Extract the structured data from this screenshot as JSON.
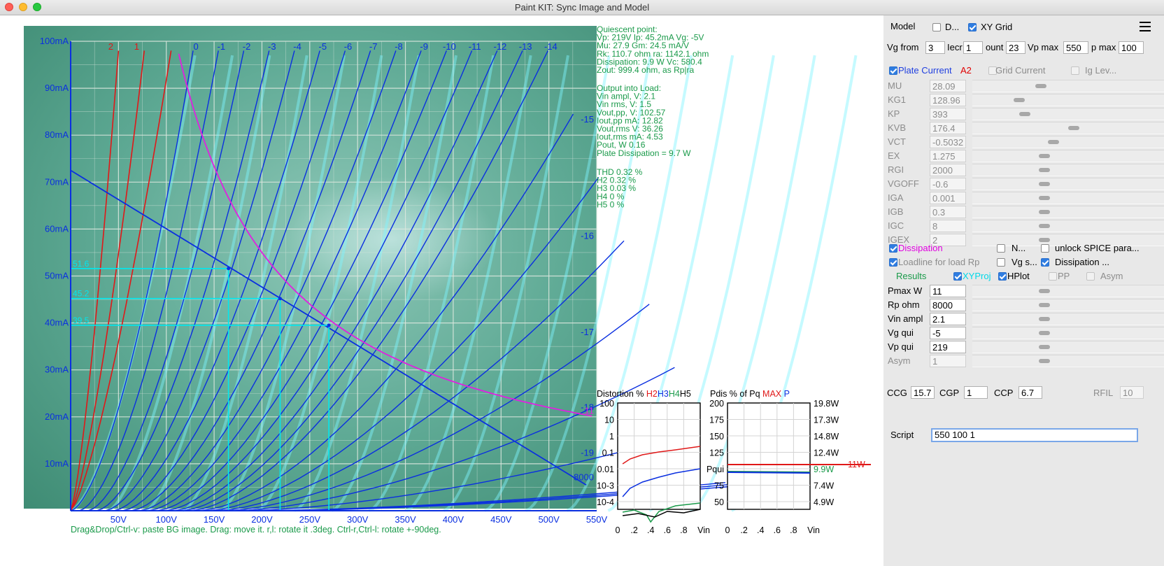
{
  "window": {
    "title": "Paint KIT: Sync Image and Model"
  },
  "chart_data": {
    "type": "line",
    "title": "",
    "xlabel": "",
    "ylabel": "",
    "xlim": [
      0,
      550
    ],
    "ylim": [
      0,
      100
    ],
    "x_ticks": [
      "50V",
      "100V",
      "150V",
      "200V",
      "250V",
      "300V",
      "350V",
      "400V",
      "450V",
      "500V",
      "550V"
    ],
    "y_ticks": [
      "10mA",
      "20mA",
      "30mA",
      "40mA",
      "50mA",
      "60mA",
      "70mA",
      "80mA",
      "90mA",
      "100mA"
    ],
    "grid": true,
    "positive_grid_labels": [
      "2",
      "1"
    ],
    "curve_top_labels": [
      "0",
      "-1",
      "-2",
      "-3",
      "-4",
      "-5",
      "-6",
      "-7",
      "-8",
      "-9",
      "-10",
      "-11",
      "-12",
      "-13",
      "-14"
    ],
    "curve_side_labels": [
      {
        "text": "-15",
        "y": 83.3
      },
      {
        "text": "-16",
        "y": 58.5
      },
      {
        "text": "-17",
        "y": 38.0
      },
      {
        "text": "-18",
        "y": 22.0
      },
      {
        "text": "-19",
        "y": 12.3
      },
      {
        "text": "8000",
        "y": 7.1
      },
      {
        "text": "11",
        "y": 21.2
      }
    ],
    "loadline": {
      "x": [
        0,
        539
      ],
      "y": [
        72.5,
        5.5
      ],
      "label": "8000"
    },
    "dissipation_curve_W": 11,
    "projections": [
      {
        "label": "51.6",
        "x": 165,
        "y": 51.6
      },
      {
        "label": "45.2",
        "x": 219,
        "y": 45.2
      },
      {
        "label": "39.5",
        "x": 270,
        "y": 39.5
      }
    ]
  },
  "help_text": "Drag&Drop/Ctrl-v: paste BG image. Drag: move it. r,l: rotate it .3deg. Ctrl-r,Ctrl-l: rotate +-90deg.",
  "info": {
    "quiescent": [
      "Quiescent point:",
      "Vp: 219V  Ip: 45.2mA  Vg: -5V",
      "Mu: 27.9 Gm: 24.5 mA/V",
      "Rk: 110.7 ohm ra: 1142.1 ohm",
      "Dissipation: 9.9 W Vc: 580.4",
      "Zout: 999.4 ohm, as Rp|ra"
    ],
    "output": [
      "Output into Load:",
      "Vin ampl, V: 2.1",
      "Vin rms,  V: 1.5",
      "Vout,pp,   V: 102.57",
      "Iout,pp   mA: 12.82",
      "Vout,rms   V: 36.26",
      "Iout,rms  mA: 4.53",
      "Pout, W       0.16",
      "Plate Dissipation = 9.7 W"
    ],
    "thd": [
      "THD 0.32 %",
      "  H2 0.32 %",
      "  H3 0.03 %",
      "  H4 0 %",
      "  H5 0 %"
    ]
  },
  "distortion_plot": {
    "title_prefix": "Distortion %",
    "h2": "H2",
    "h3": "H3",
    "h4": "H4",
    "h5": "H5",
    "y_labels": [
      "100",
      "10",
      "1",
      "0.1",
      "0.01",
      "10-3",
      "10-4"
    ],
    "x_labels": [
      "0",
      ".2",
      ".4",
      ".6",
      ".8",
      "Vin"
    ]
  },
  "pdis_plot": {
    "title_prefix": "Pdis % of Pq",
    "max": "MAX",
    "p": "P",
    "y_labels": [
      "200",
      "175",
      "150",
      "125",
      "Pqui",
      "75",
      "50"
    ],
    "w_labels": [
      "19.8W",
      "17.3W",
      "14.8W",
      "12.4W",
      "9.9W",
      "7.4W",
      "4.9W"
    ],
    "x_labels": [
      "0",
      ".2",
      ".4",
      ".6",
      ".8",
      "Vin"
    ],
    "max_label": "11W"
  },
  "panel": {
    "model_label": "Model",
    "d_label": "D...",
    "xygrid_label": "XY Grid",
    "vg_from_label": "Vg from",
    "vg_from": "3",
    "incr_label": "Iecr",
    "incr": "1",
    "count_label": "ount",
    "count": "23",
    "vpmax_label": "Vp max",
    "vpmax": "550",
    "ipmax_label": "p max",
    "ipmax": "100",
    "plate_current": "Plate Current",
    "a2": "A2",
    "grid_current": "Grid Current",
    "ig_lev": "Ig Lev...",
    "params": [
      {
        "name": "MU",
        "value": "28.09",
        "knob": 0.35
      },
      {
        "name": "KG1",
        "value": "128.96",
        "knob": 0.23
      },
      {
        "name": "KP",
        "value": "393",
        "knob": 0.26
      },
      {
        "name": "KVB",
        "value": "176.4",
        "knob": 0.53
      },
      {
        "name": "VCT",
        "value": "-0.5032",
        "knob": 0.42
      },
      {
        "name": "EX",
        "value": "1.275",
        "knob": 0.37
      },
      {
        "name": "RGI",
        "value": "2000",
        "knob": 0.37
      },
      {
        "name": "VGOFF",
        "value": "-0.6",
        "knob": 0.37
      },
      {
        "name": "IGA",
        "value": "0.001",
        "knob": 0.37
      },
      {
        "name": "IGB",
        "value": "0.3",
        "knob": 0.37
      },
      {
        "name": "IGC",
        "value": "8",
        "knob": 0.37
      },
      {
        "name": "IGEX",
        "value": "2",
        "knob": 0.37
      }
    ],
    "dissipation": "Dissipation",
    "n_label": "N...",
    "unlock": "unlock SPICE para...",
    "loadline": "Loadline for load Rp",
    "vgs": "Vg s...",
    "dissipation2": "Dissipation ...",
    "results": "Results",
    "xyproj": "XYProj",
    "hplot": "HPlot",
    "pp": "PP",
    "asym": "Asym",
    "results_params": [
      {
        "name": "Pmax W",
        "value": "11",
        "knob": 0.37
      },
      {
        "name": "Rp ohm",
        "value": "8000",
        "knob": 0.37
      },
      {
        "name": "Vin ampl",
        "value": "2.1",
        "knob": 0.37
      },
      {
        "name": "Vg qui",
        "value": "-5",
        "knob": 0.37
      },
      {
        "name": "Vp qui",
        "value": "219",
        "knob": 0.37
      },
      {
        "name": "Asym",
        "value": "1",
        "knob": 0.37
      }
    ],
    "ccg_label": "CCG",
    "ccg": "15.7",
    "cgp_label": "CGP",
    "cgp": "1",
    "ccp_label": "CCP",
    "ccp": "6.7",
    "rfil_label": "RFIL",
    "rfil": "10",
    "script_label": "Script",
    "script": "550 100 1"
  }
}
